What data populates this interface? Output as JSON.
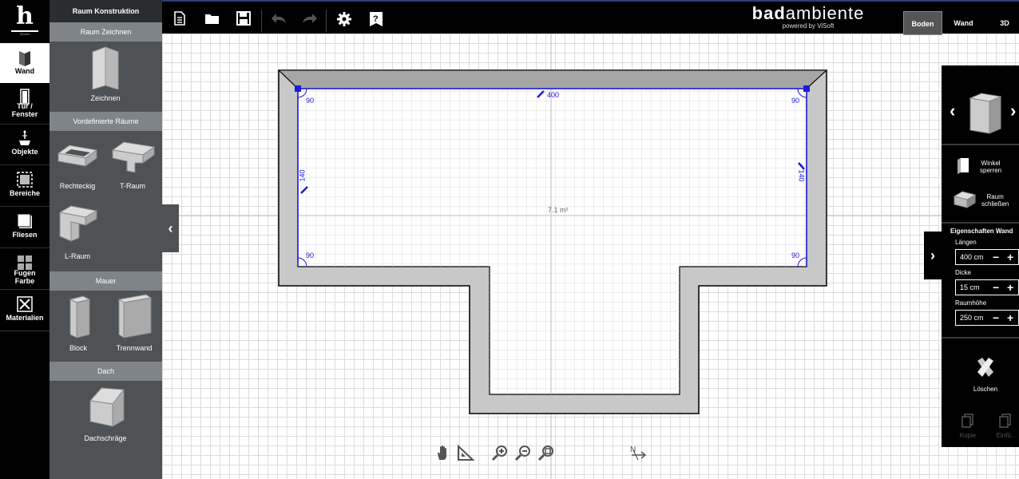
{
  "app": {
    "logo_letter": "h",
    "logo_sub": "Klosen",
    "brand_name_bold": "bad",
    "brand_name_rest": "ambiente",
    "brand_powered": "powered by ViSoft"
  },
  "view_tabs": [
    {
      "label": "Boden",
      "active": true
    },
    {
      "label": "Wand",
      "active": false
    },
    {
      "label": "3D",
      "active": false
    }
  ],
  "toolbar": [
    {
      "name": "new-document-icon"
    },
    {
      "name": "open-folder-icon"
    },
    {
      "name": "save-icon"
    },
    {
      "name": "undo-icon"
    },
    {
      "name": "redo-icon"
    },
    {
      "name": "settings-gear-icon"
    },
    {
      "name": "help-icon"
    }
  ],
  "left_nav": [
    {
      "label": "Wand",
      "active": true
    },
    {
      "label": "Tür /\nFenster"
    },
    {
      "label": "Objekte"
    },
    {
      "label": "Bereiche"
    },
    {
      "label": "Fliesen"
    },
    {
      "label": "Fugen\nFarbe"
    },
    {
      "label": "Materialien"
    }
  ],
  "panel": {
    "title": "Raum Konstruktion",
    "sections": {
      "draw": "Raum Zeichnen",
      "predefined": "Vordefinierte Räume",
      "wall": "Mauer",
      "roof": "Dach"
    },
    "tools": {
      "zeichnen": "Zeichnen",
      "rechteckig": "Rechteckig",
      "t_raum": "T-Raum",
      "l_raum": "L-Raum",
      "block": "Block",
      "trennwand": "Trennwand",
      "dachschraege": "Dachschräge"
    }
  },
  "plan": {
    "area_label": "7.1 m²",
    "dim_top": "400",
    "dim_left": "140",
    "dim_right": "140",
    "angles": [
      "90",
      "90",
      "90",
      "90"
    ]
  },
  "right_panel": {
    "winkel": "Winkel\nsperren",
    "raum": "Raum\nschließen",
    "properties_header": "Eigenschaften Wand",
    "laengen_label": "Längen",
    "laengen_value": "400 cm",
    "dicke_label": "Dicke",
    "dicke_value": "15 cm",
    "raumhoehe_label": "Raumhöhe",
    "raumhoehe_value": "250 cm",
    "loeschen": "Löschen",
    "kopie": "Kopie",
    "einfuegen": "Einfü.."
  },
  "colors": {
    "topbar": "#000000",
    "panel": "#4e5255",
    "section": "#7e8487",
    "wall_fill": "#c8c8c8",
    "selection": "#1a1adc"
  }
}
